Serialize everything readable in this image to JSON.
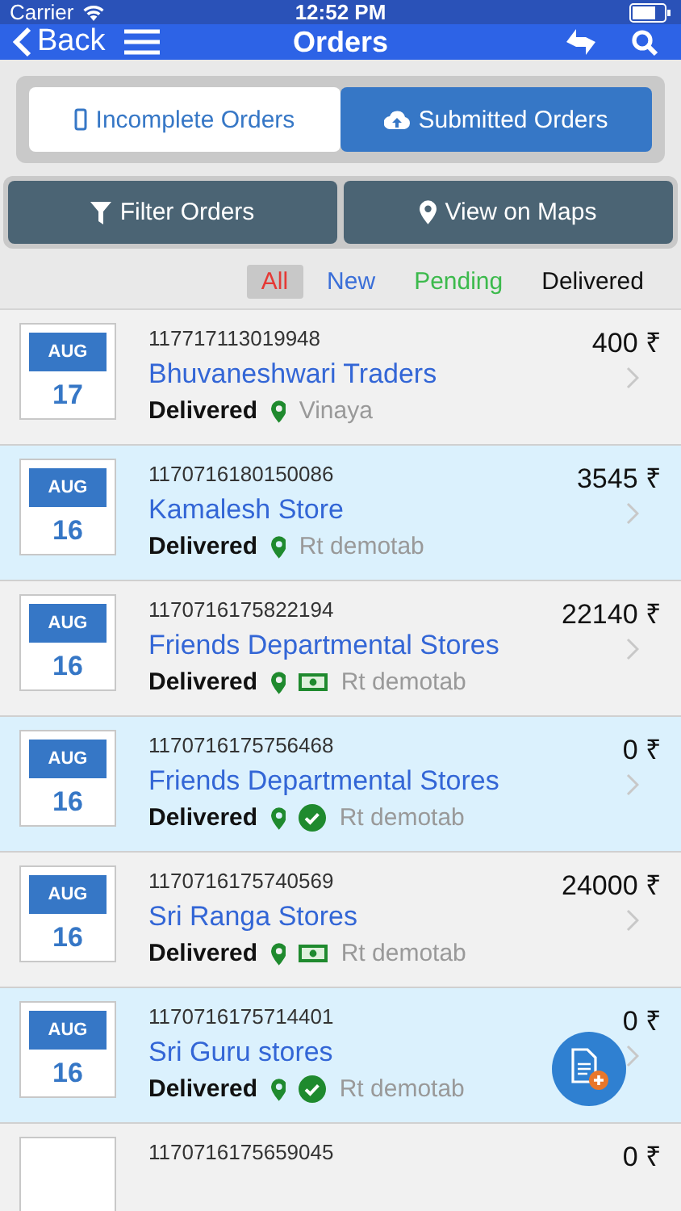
{
  "status_bar": {
    "carrier": "Carrier",
    "time": "12:52 PM"
  },
  "nav": {
    "back": "Back",
    "title": "Orders"
  },
  "tabs": [
    {
      "label": "Incomplete Orders",
      "kind": "phone",
      "selected": false
    },
    {
      "label": "Submitted Orders",
      "kind": "cloud",
      "selected": true
    }
  ],
  "actions": [
    {
      "label": "Filter Orders",
      "kind": "filter"
    },
    {
      "label": "View on Maps",
      "kind": "pin"
    }
  ],
  "filters": [
    {
      "label": "All",
      "color": "#e53935",
      "selected": true
    },
    {
      "label": "New",
      "color": "#3b6fd8",
      "selected": false
    },
    {
      "label": "Pending",
      "color": "#3cba4c",
      "selected": false
    },
    {
      "label": "Delivered",
      "color": "#111111",
      "selected": false
    }
  ],
  "orders": [
    {
      "month": "AUG",
      "day": "17",
      "order_id": "117717113019948",
      "customer": "Bhuvaneshwari Traders",
      "status": "Delivered",
      "kind": "plain",
      "salesperson": "Vinaya",
      "amount": "400 ₹"
    },
    {
      "month": "AUG",
      "day": "16",
      "order_id": "1170716180150086",
      "customer": "Kamalesh Store",
      "status": "Delivered",
      "kind": "plain",
      "salesperson": "Rt demotab",
      "amount": "3545 ₹"
    },
    {
      "month": "AUG",
      "day": "16",
      "order_id": "1170716175822194",
      "customer": "Friends Departmental Stores",
      "status": "Delivered",
      "kind": "cash",
      "salesperson": "Rt demotab",
      "amount": "22140 ₹"
    },
    {
      "month": "AUG",
      "day": "16",
      "order_id": "1170716175756468",
      "customer": "Friends Departmental Stores",
      "status": "Delivered",
      "kind": "paid",
      "salesperson": "Rt demotab",
      "amount": "0 ₹"
    },
    {
      "month": "AUG",
      "day": "16",
      "order_id": "1170716175740569",
      "customer": "Sri Ranga Stores",
      "status": "Delivered",
      "kind": "cash",
      "salesperson": "Rt demotab",
      "amount": "24000 ₹"
    },
    {
      "month": "AUG",
      "day": "16",
      "order_id": "1170716175714401",
      "customer": "Sri Guru stores",
      "status": "Delivered",
      "kind": "paid",
      "salesperson": "Rt demotab",
      "amount": "0 ₹"
    },
    {
      "order_id": "1170716175659045",
      "amount": "0 ₹"
    }
  ]
}
